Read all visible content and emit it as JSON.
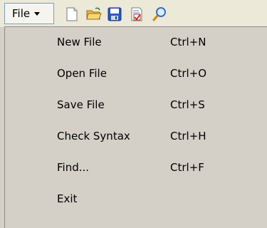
{
  "toolbar": {
    "file_menu_label": "File",
    "icons": [
      "new-file-icon",
      "open-folder-icon",
      "save-disk-icon",
      "check-syntax-icon",
      "find-magnifier-icon"
    ]
  },
  "menu": {
    "items": [
      {
        "label": "New File",
        "shortcut": "Ctrl+N"
      },
      {
        "label": "Open File",
        "shortcut": "Ctrl+O"
      },
      {
        "label": "Save File",
        "shortcut": "Ctrl+S"
      },
      {
        "label": "Check Syntax",
        "shortcut": "Ctrl+H"
      },
      {
        "label": "Find...",
        "shortcut": "Ctrl+F"
      },
      {
        "label": "Exit",
        "shortcut": ""
      }
    ]
  }
}
